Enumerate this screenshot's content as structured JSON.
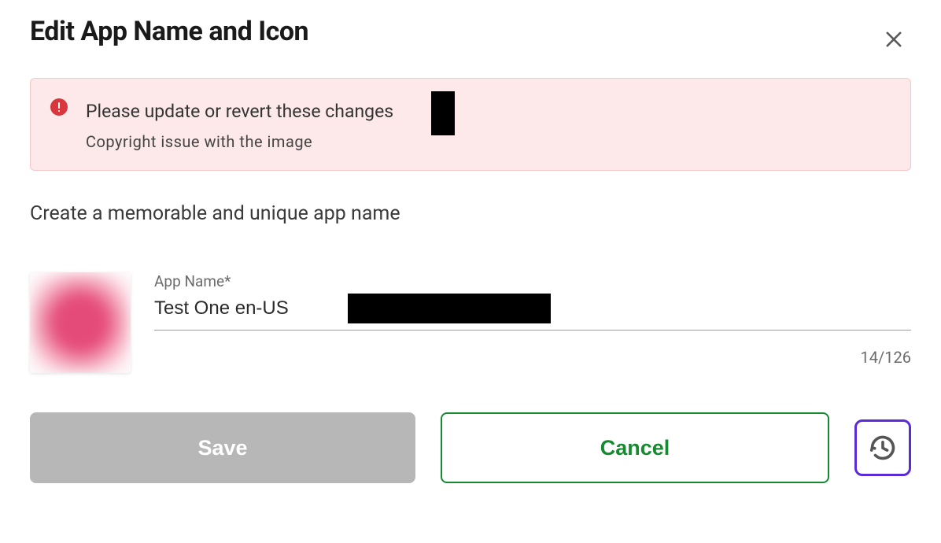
{
  "header": {
    "title": "Edit App Name and Icon"
  },
  "alert": {
    "title": "Please update or revert these changes",
    "subtitle": "Copyright issue with the image"
  },
  "helper": "Create a memorable and unique app name",
  "form": {
    "app_name_label": "App Name*",
    "app_name_value": "Test One en-US",
    "char_counter": "14/126"
  },
  "buttons": {
    "save": "Save",
    "cancel": "Cancel"
  }
}
